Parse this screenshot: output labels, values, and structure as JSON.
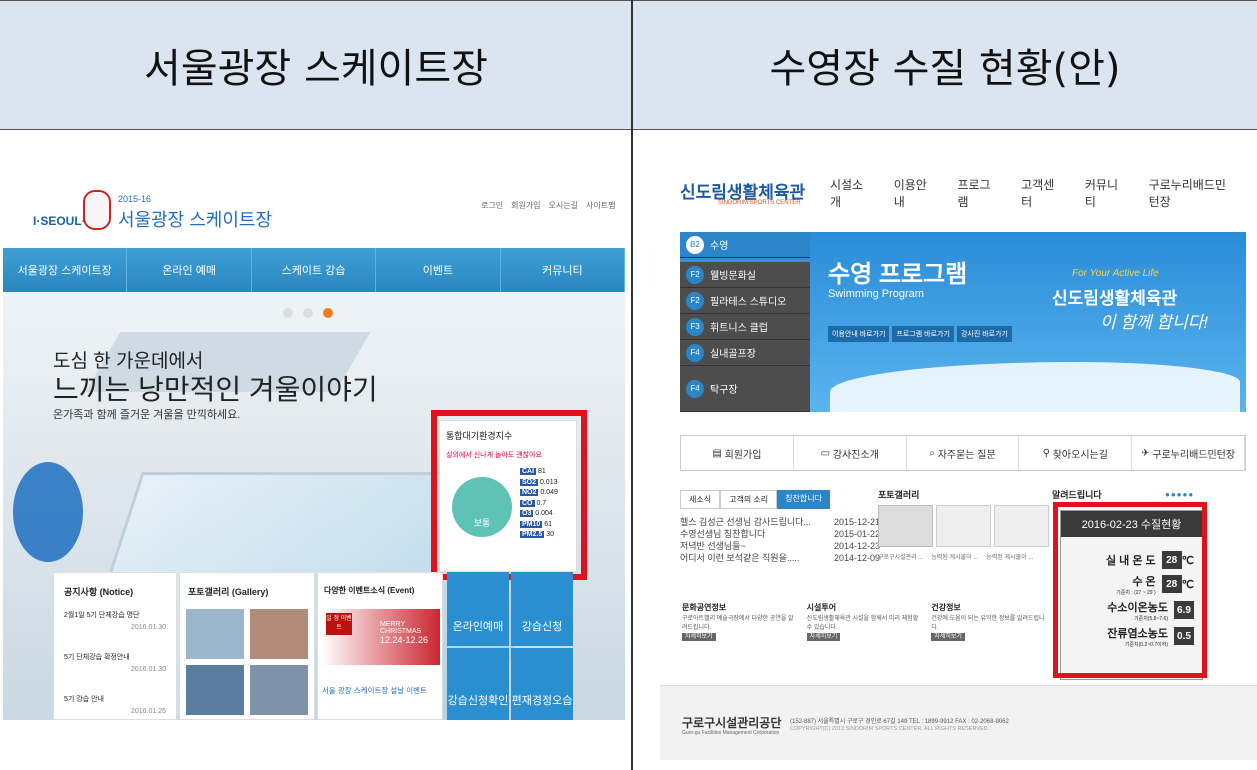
{
  "headers": {
    "left": "서울광장 스케이트장",
    "right": "수영장 수질 현황(안)"
  },
  "left_site": {
    "logo_text": "I·SEOUL·U",
    "season": "2015-16",
    "title": "서울광장 스케이트장",
    "top_links": [
      "로그인",
      "회원가입",
      "오시는길",
      "사이트맵"
    ],
    "nav": [
      "서울광장 스케이트장",
      "온라인 예매",
      "스케이트 강습",
      "이벤트",
      "커뮤니티"
    ],
    "hero_line1": "도심 한 가운데에서",
    "hero_line2": "느끼는 낭만적인 겨울이야기",
    "hero_line3": "온가족과 함께 즐거운 겨울을 만끽하세요.",
    "air": {
      "title": "통합대기환경지수",
      "note": "실외에서 신나게 놀아도 괜찮아요",
      "status": "보통",
      "items": [
        {
          "k": "CAI",
          "v": "81"
        },
        {
          "k": "SO2",
          "v": "0.013"
        },
        {
          "k": "NO2",
          "v": "0.049"
        },
        {
          "k": "CO",
          "v": "0.7"
        },
        {
          "k": "O3",
          "v": "0.004"
        },
        {
          "k": "PM10",
          "v": "61"
        },
        {
          "k": "PM2.5",
          "v": "30"
        }
      ]
    },
    "notice_title": "공지사항 (Notice)",
    "notices": [
      {
        "t": "2월1일 5기 단체강습 명단",
        "d": "2016.01.30"
      },
      {
        "t": "5기 단체강습 확정안내",
        "d": "2016.01.30"
      },
      {
        "t": "5기 강습 안내",
        "d": "2016.01.25"
      }
    ],
    "gallery_title": "포토갤러리 (Gallery)",
    "event_title": "다양한 이벤트소식 (Event)",
    "event_badge": "일 정 이벤트",
    "event_xmas": "MERRY CHRISTMAS",
    "event_dates": "12.24-12.26",
    "event_caption": "서울 광장 스케이트장 설날 이벤트",
    "quick": [
      "온라인예매",
      "강습신청",
      "강습신청확인",
      "편재경정오습"
    ]
  },
  "right_site": {
    "logo": "신도림생활체육관",
    "logo_sub": "SINDORIM SPORTS CENTER",
    "menu": [
      "시설소개",
      "이용안내",
      "프로그램",
      "고객센터",
      "커뮤니티",
      "구로누리배드민턴장"
    ],
    "facilities": [
      {
        "n": "B2",
        "t": "수영"
      },
      {
        "n": "F2",
        "t": "웰빙문화실"
      },
      {
        "n": "F2",
        "t": "필라테스 스튜디오"
      },
      {
        "n": "F3",
        "t": "휘트니스 클럽"
      },
      {
        "n": "F4",
        "t": "실내골프장"
      },
      {
        "n": "F4",
        "t": "탁구장"
      }
    ],
    "banner_title": "수영 프로그램",
    "banner_sub": "Swimming Program",
    "banner_btns": [
      "이용안내 바로가기",
      "프로그램 바로가기",
      "강사진 바로가기"
    ],
    "banner_right1": "For Your Active Life",
    "banner_right2": "신도림생활체육관",
    "banner_right3": "이 함께 합니다!",
    "quicklinks": [
      "회원가입",
      "강사진소개",
      "자주묻는 질문",
      "찾아오시는길",
      "구로누리배드민턴장"
    ],
    "tabs": [
      "새소식",
      "고객의 소리",
      "칭찬합니다"
    ],
    "news": [
      {
        "t": "헬스 김성근 선생님 감사드립니다...",
        "d": "2015-12-21"
      },
      {
        "t": "수영선생님 칭찬합니다",
        "d": "2015-01-22"
      },
      {
        "t": "저녁반 선생님들~",
        "d": "2014-12-23"
      },
      {
        "t": "어디서 이런 보석같은 직원을.....",
        "d": "2014-12-09"
      }
    ],
    "photo_title": "포토갤러리",
    "photo_caps": [
      "구로구시설관리 ...",
      "능력된 게시물이 ...",
      "능력된 게시물이 ..."
    ],
    "notice_title": "알려드립니다",
    "cards": [
      {
        "t": "문화공연정보",
        "d": "구로아트밸리 예술극장에서 다양한 공연을 알려드립니다."
      },
      {
        "t": "시설투어",
        "d": "신도림생활체육관 시설을 함께서 미리 체험할수 있습니다."
      },
      {
        "t": "건강정보",
        "d": "건강에 도움이 되는 유익한 정보를 알려드립니다."
      }
    ],
    "card_btn": "자세히보기",
    "wq": {
      "title": "2016-02-23 수질현황",
      "rows": [
        {
          "k": "실 내 온 도",
          "s": "",
          "v": "28",
          "u": "℃"
        },
        {
          "k": "수     온",
          "s": "기준치 : (27 ~ 29 )",
          "v": "28",
          "u": "℃"
        },
        {
          "k": "수소이온농도",
          "s": "기준치(5.8~7.6)",
          "v": "6.9",
          "u": ""
        },
        {
          "k": "잔류염소농도",
          "s": "기준치(0.2~0.7이하)",
          "v": "0.5",
          "u": ""
        }
      ]
    },
    "footer_org": "구로구시설관리공단",
    "footer_org_en": "Guro-gu Facilities Management Corporation",
    "footer_addr": "(152-887) 서울특별시 구로구 경인로 67길 149  TEL : 1899-9912  FAX : 02-2068-9062",
    "footer_copy": "COPYRIGHT(C) 2013 SINDORIM SPORTS CENTER. ALL RIGHTS RESERVED."
  }
}
